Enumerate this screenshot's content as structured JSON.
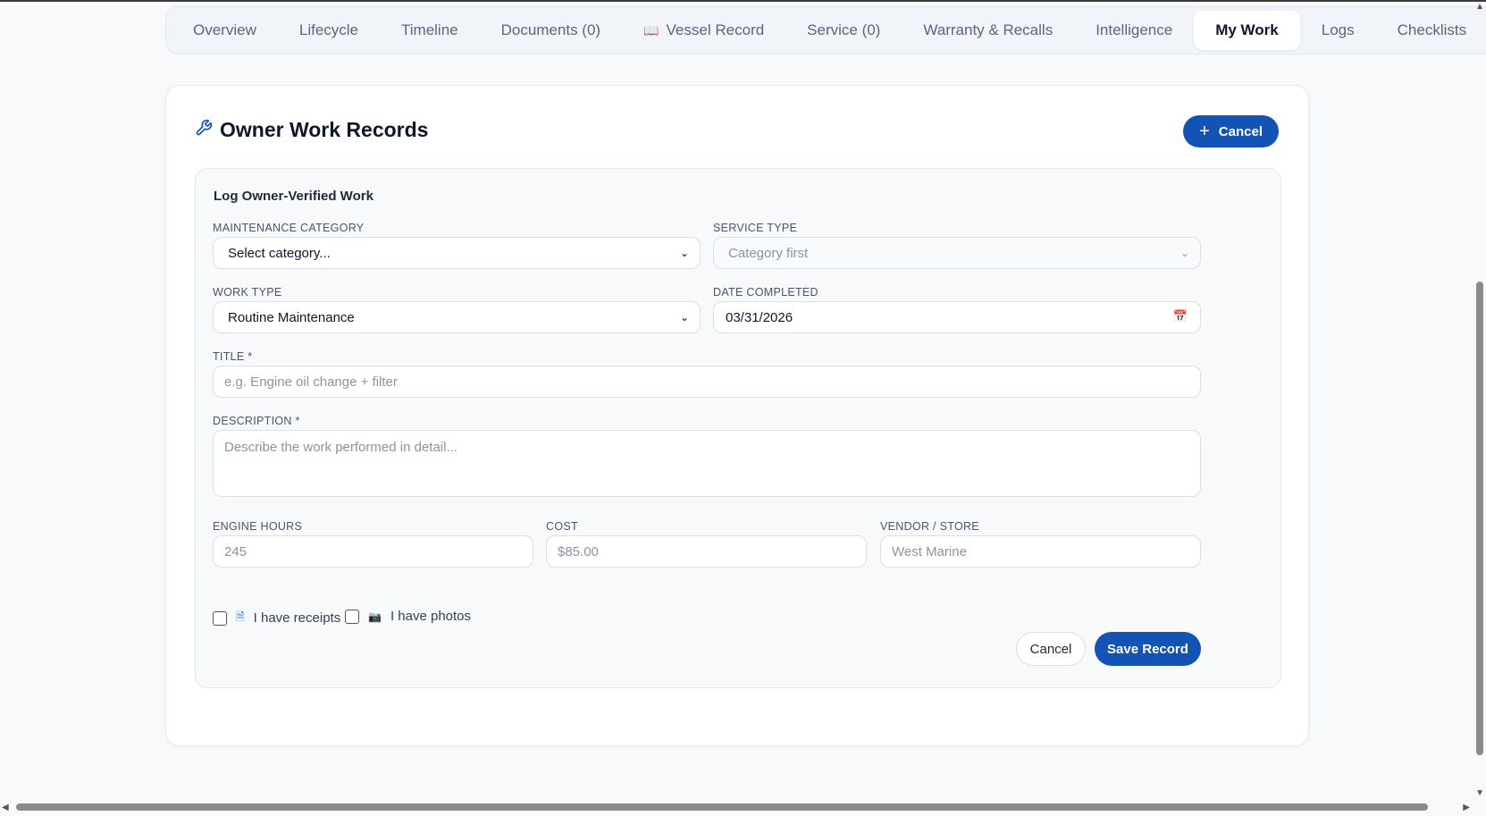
{
  "tabs": [
    "Overview",
    "Lifecycle",
    "Timeline",
    "Documents (0)",
    "Vessel Record",
    "Service (0)",
    "Warranty & Recalls",
    "Intelligence",
    "My Work",
    "Logs",
    "Checklists"
  ],
  "active_tab": "My Work",
  "card": {
    "title": "Owner Work Records",
    "toggle_label": "Cancel"
  },
  "form": {
    "title": "Log Owner-Verified Work",
    "category": {
      "label": "MAINTENANCE CATEGORY",
      "value": "Select category..."
    },
    "service_type": {
      "label": "SERVICE TYPE",
      "value": "Category first"
    },
    "work_type": {
      "label": "WORK TYPE",
      "value": "Routine Maintenance"
    },
    "date": {
      "label": "DATE COMPLETED",
      "value": "03/31/2026"
    },
    "title_field": {
      "label": "TITLE *",
      "placeholder": "e.g. Engine oil change + filter"
    },
    "description": {
      "label": "DESCRIPTION *",
      "placeholder": "Describe the work performed in detail..."
    },
    "engine_hours": {
      "label": "ENGINE HOURS",
      "placeholder": "245"
    },
    "cost": {
      "label": "COST",
      "placeholder": "$85.00"
    },
    "vendor": {
      "label": "VENDOR / STORE",
      "placeholder": "West Marine"
    },
    "receipts_label": "I have receipts",
    "photos_label": "I have photos",
    "cancel_label": "Cancel",
    "save_label": "Save Record"
  },
  "colors": {
    "accent": "#1453b6"
  }
}
